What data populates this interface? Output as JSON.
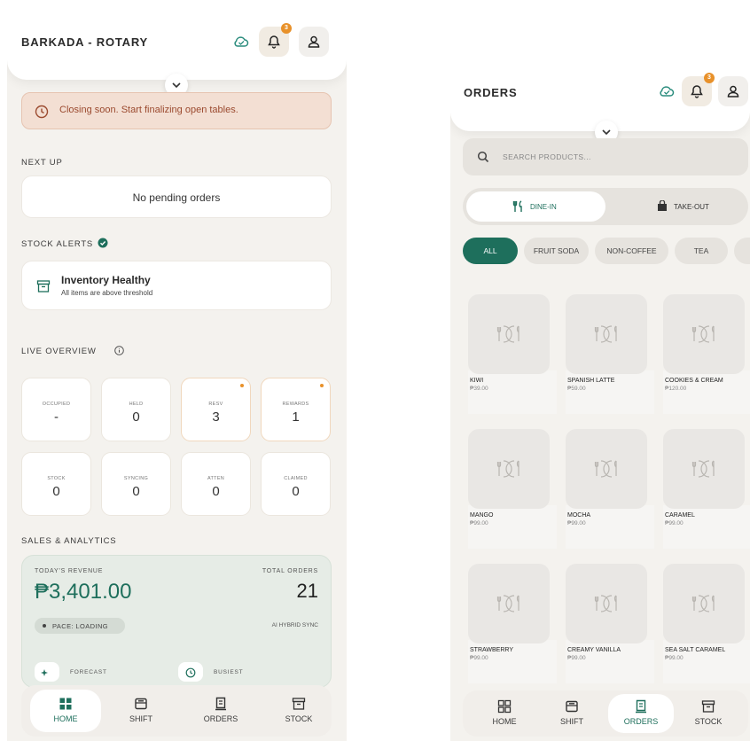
{
  "home": {
    "title": "BARKADA - ROTARY",
    "badge_count": "3",
    "alert": "Closing soon. Start finalizing open tables.",
    "next_up": {
      "heading": "NEXT UP",
      "empty": "No pending orders"
    },
    "stock_alerts": {
      "heading": "STOCK ALERTS",
      "title": "Inventory Healthy",
      "subtitle": "All items are above threshold"
    },
    "live_overview": {
      "heading": "LIVE OVERVIEW",
      "tiles": [
        {
          "label": "OCCUPIED",
          "value": "-",
          "highlight": false
        },
        {
          "label": "HELD",
          "value": "0",
          "highlight": false
        },
        {
          "label": "RESV",
          "value": "3",
          "highlight": true
        },
        {
          "label": "REWARDS",
          "value": "1",
          "highlight": true
        },
        {
          "label": "STOCK",
          "value": "0",
          "highlight": false
        },
        {
          "label": "SYNCING",
          "value": "0",
          "highlight": false
        },
        {
          "label": "ATTEN",
          "value": "0",
          "highlight": false
        },
        {
          "label": "CLAIMED",
          "value": "0",
          "highlight": false
        }
      ]
    },
    "sales": {
      "heading": "SALES & ANALYTICS",
      "revenue_label": "TODAY'S REVENUE",
      "revenue": "₱3,401.00",
      "orders_label": "TOTAL ORDERS",
      "orders": "21",
      "pace": "PACE: LOADING",
      "sync": "AI HYBRID SYNC",
      "forecast": "FORECAST",
      "busiest": "BUSIEST"
    }
  },
  "orders": {
    "title": "ORDERS",
    "badge_count": "3",
    "search_placeholder": "SEARCH PRODUCTS...",
    "dine_in": "DINE-IN",
    "take_out": "TAKE-OUT",
    "categories": [
      "ALL",
      "FRUIT SODA",
      "NON-COFFEE",
      "TEA"
    ],
    "products": [
      {
        "name": "KIWI",
        "price": "₱39.00"
      },
      {
        "name": "SPANISH LATTE",
        "price": "₱59.00"
      },
      {
        "name": "COOKIES & CREAM",
        "price": "₱120.00"
      },
      {
        "name": "MANGO",
        "price": "₱99.00"
      },
      {
        "name": "MOCHA",
        "price": "₱99.00"
      },
      {
        "name": "CARAMEL",
        "price": "₱99.00"
      },
      {
        "name": "STRAWBERRY",
        "price": "₱99.00"
      },
      {
        "name": "CREAMY VANILLA",
        "price": "₱99.00"
      },
      {
        "name": "SEA SALT CARAMEL",
        "price": "₱99.00"
      }
    ]
  },
  "nav": {
    "home": "HOME",
    "shift": "SHIFT",
    "orders": "ORDERS",
    "stock": "STOCK"
  },
  "colors": {
    "accent": "#1e6f5c",
    "badge": "#e8912a",
    "alert_bg": "#f3dfd3",
    "alert_text": "#9b4a2f"
  }
}
